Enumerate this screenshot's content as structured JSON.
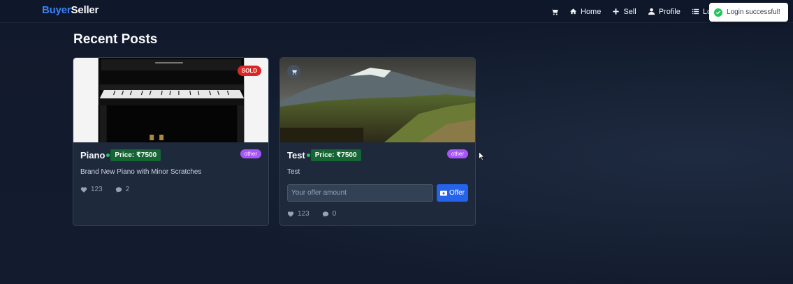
{
  "navbar": {
    "brand_part1": "Buyer",
    "brand_part2": "Seller",
    "links": [
      {
        "label": "Home",
        "icon": "home-icon"
      },
      {
        "label": "Sell",
        "icon": "plus-icon"
      },
      {
        "label": "Profile",
        "icon": "user-icon"
      },
      {
        "label": "Logou",
        "icon": "list-icon"
      }
    ]
  },
  "toast": {
    "message": "Login successful!",
    "icon": "check-circle-icon"
  },
  "page": {
    "title": "Recent Posts"
  },
  "posts": [
    {
      "title": "Piano",
      "price": "Price: ₹7500",
      "category": "other",
      "badge": "SOLD",
      "description": "Brand New Piano with Minor Scratches",
      "likes": "123",
      "comments": "2"
    },
    {
      "title": "Test",
      "price": "Price: ₹7500",
      "category": "other",
      "description": "Test",
      "offer_placeholder": "Your offer amount",
      "offer_button": "Offer",
      "likes": "123",
      "comments": "0"
    }
  ],
  "colors": {
    "brand_accent": "#3b82f6",
    "price_green": "#166534",
    "sold_red": "#dc2626",
    "category_purple": "#a855f7",
    "offer_blue": "#2563eb"
  }
}
